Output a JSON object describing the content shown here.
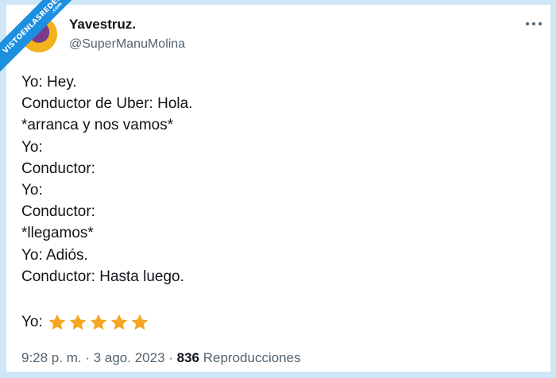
{
  "watermark": {
    "text": "VISTOENLASREDES",
    "suffix": ".com"
  },
  "tweet": {
    "display_name": "Yavestruz.",
    "handle": "@SuperManuMolina",
    "lines": [
      "Yo: Hey.",
      "Conductor de Uber: Hola.",
      "*arranca y nos vamos*",
      "Yo:",
      "Conductor:",
      "Yo:",
      "Conductor:",
      "*llegamos*",
      "Yo: Adiós.",
      "Conductor: Hasta luego."
    ],
    "rating_label": "Yo:",
    "rating_stars": 5,
    "time": "9:28 p. m.",
    "separator_1": " · ",
    "date": "3 ago. 2023",
    "separator_2": " · ",
    "views_count": "836",
    "views_label": " Reproducciones"
  },
  "colors": {
    "background": "#cfe6f6",
    "card": "#ffffff",
    "text_primary": "#0f1419",
    "text_secondary": "#536471",
    "star": "#f5a623",
    "watermark": "#1d8fe0"
  },
  "icons": {
    "more": "more-horizontal-icon",
    "star": "star-icon"
  }
}
